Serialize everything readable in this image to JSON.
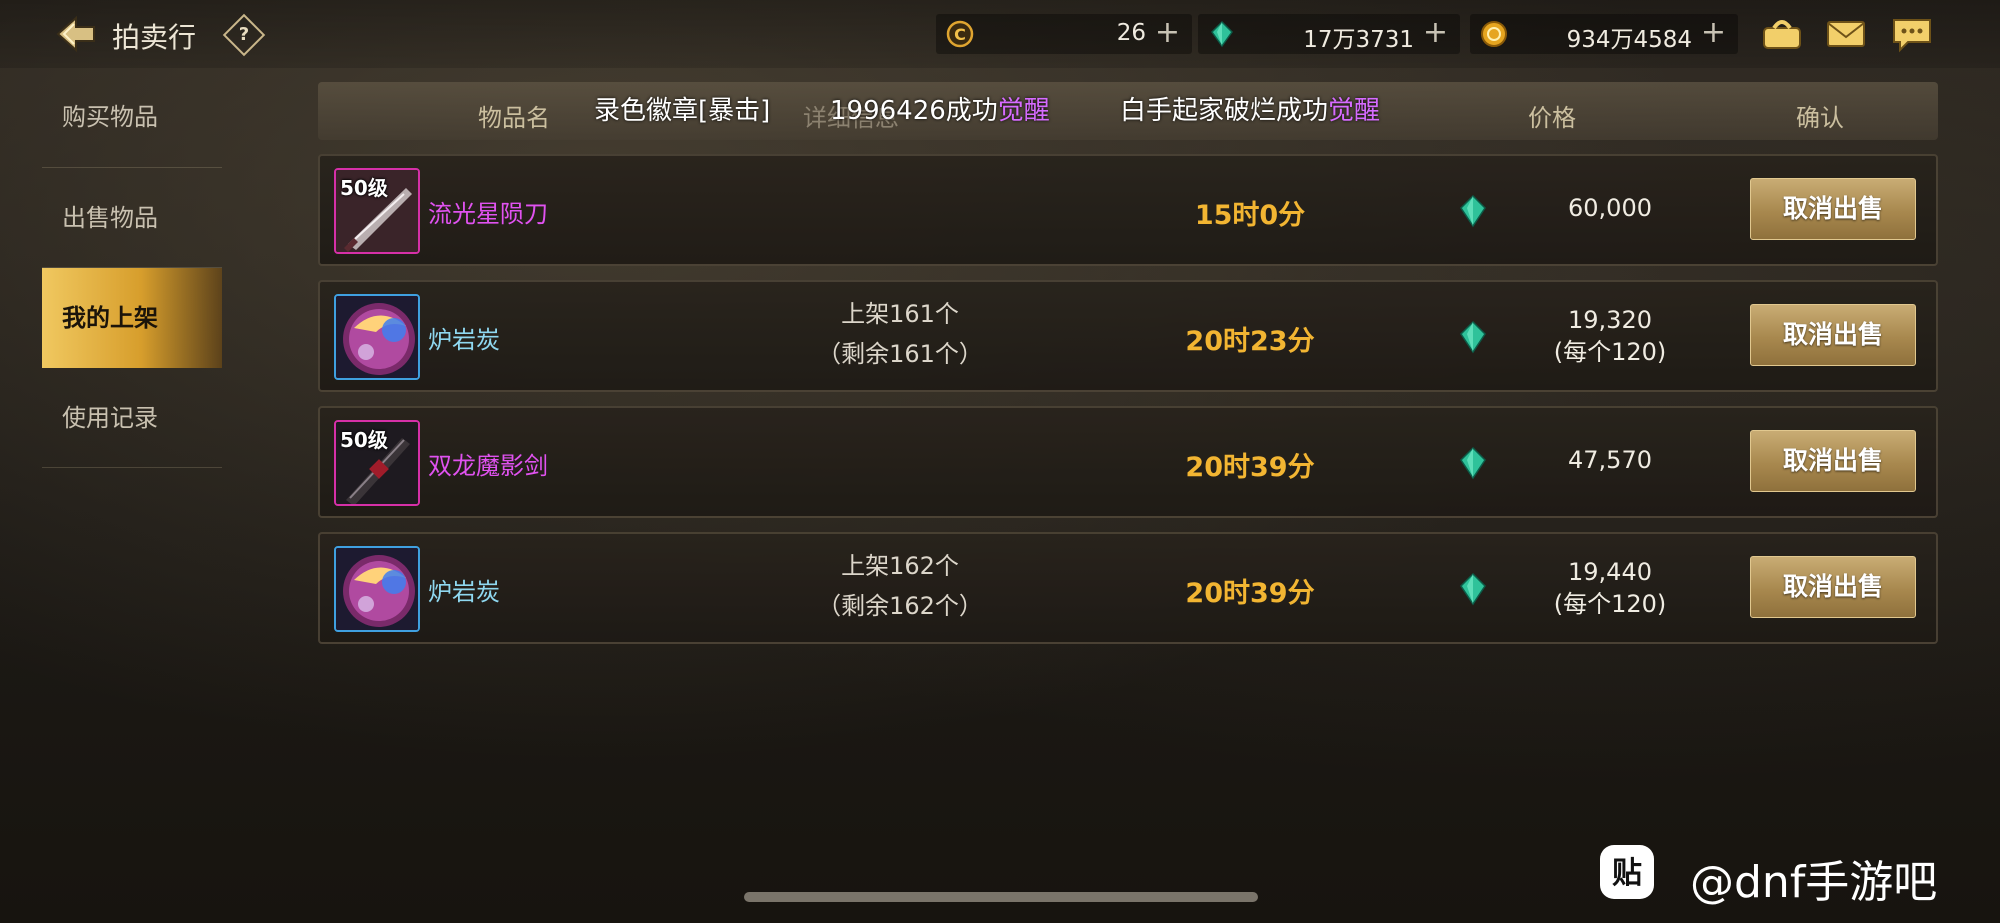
{
  "header": {
    "title": "拍卖行",
    "help_label": "?",
    "currencies": [
      {
        "name": "c-coin",
        "value": "26",
        "plus": "+"
      },
      {
        "name": "gem",
        "value": "17万3731",
        "plus": "+"
      },
      {
        "name": "gold",
        "value": "934万4584",
        "plus": "+"
      }
    ]
  },
  "sidebar": {
    "items": [
      {
        "label": "购买物品",
        "active": false
      },
      {
        "label": "出售物品",
        "active": false
      },
      {
        "label": "我的上架",
        "active": true
      },
      {
        "label": "使用记录",
        "active": false
      }
    ]
  },
  "table": {
    "headers": {
      "name": "物品名",
      "detail": "详细信息",
      "price": "价格",
      "confirm": "确认"
    }
  },
  "broadcast": {
    "part1": "录色徽章[暴击]",
    "part2_prefix": "1996426成功",
    "part2_hl": "觉醒",
    "part3_prefix": "白手起家破烂成功",
    "part3_hl": "觉醒"
  },
  "rows": [
    {
      "level": "50级",
      "name": "流光星陨刀",
      "detail_line1": "",
      "detail_line2": "",
      "time": "15时0分",
      "price": "60,000",
      "price_each": "",
      "action": "取消出售"
    },
    {
      "level": "",
      "name": "炉岩炭",
      "detail_line1": "上架161个",
      "detail_line2": "（剩余161个）",
      "time": "20时23分",
      "price": "19,320",
      "price_each": "(每个120)",
      "action": "取消出售"
    },
    {
      "level": "50级",
      "name": "双龙魔影剑",
      "detail_line1": "",
      "detail_line2": "",
      "time": "20时39分",
      "price": "47,570",
      "price_each": "",
      "action": "取消出售"
    },
    {
      "level": "",
      "name": "炉岩炭",
      "detail_line1": "上架162个",
      "detail_line2": "（剩余162个）",
      "time": "20时39分",
      "price": "19,440",
      "price_each": "(每个120)",
      "action": "取消出售"
    }
  ],
  "watermark": {
    "logo_char": "贴",
    "text": "@dnf手游吧"
  },
  "colors": {
    "accent_gold": "#f2b532",
    "epic_purple": "#e052f0",
    "material_blue": "#8fd8f0",
    "button_gold": "#a8884e"
  }
}
